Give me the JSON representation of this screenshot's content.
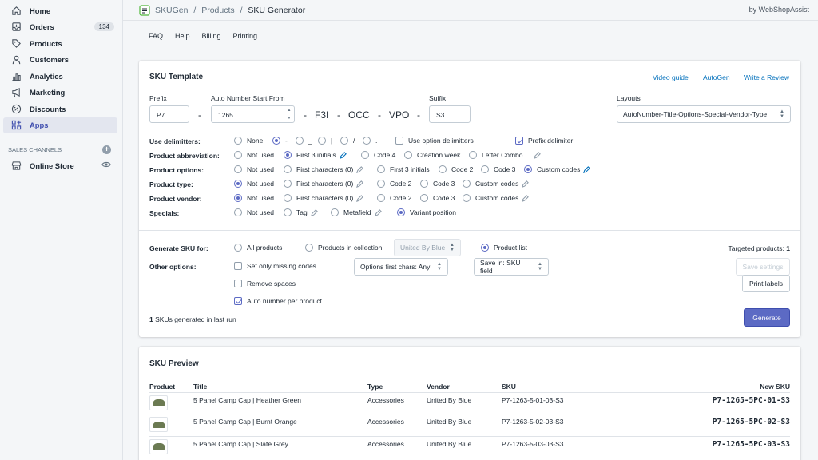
{
  "nav": {
    "items": [
      {
        "label": "Home",
        "icon": "home-icon"
      },
      {
        "label": "Orders",
        "icon": "orders-icon",
        "badge": "134"
      },
      {
        "label": "Products",
        "icon": "tag-icon"
      },
      {
        "label": "Customers",
        "icon": "person-icon"
      },
      {
        "label": "Analytics",
        "icon": "bar-chart-icon"
      },
      {
        "label": "Marketing",
        "icon": "megaphone-icon"
      },
      {
        "label": "Discounts",
        "icon": "discount-icon"
      },
      {
        "label": "Apps",
        "icon": "apps-icon"
      }
    ],
    "channels_label": "SALES CHANNELS",
    "online_store": "Online Store"
  },
  "topbar": {
    "crumb_app": "SKUGen",
    "crumb_sep1": "/",
    "crumb_products": "Products",
    "crumb_sep2": "/",
    "crumb_current": "SKU Generator",
    "byline": "by WebShopAssist"
  },
  "subnav": [
    "FAQ",
    "Help",
    "Billing",
    "Printing"
  ],
  "template": {
    "title": "SKU Template",
    "links": {
      "video": "Video guide",
      "autogen": "AutoGen",
      "review": "Write a Review"
    },
    "prefix_label": "Prefix",
    "prefix_value": "P7",
    "dash1": "-",
    "start_label": "Auto Number Start From",
    "start_value": "1265",
    "tokens": {
      "d2": "-",
      "t1": "F3I",
      "d3": "-",
      "t2": "OCC",
      "d4": "-",
      "t3": "VPO",
      "d5": "-"
    },
    "suffix_label": "Suffix",
    "suffix_value": "S3",
    "layouts_label": "Layouts",
    "layouts_value": "AutoNumber-Title-Options-Special-Vendor-Type",
    "delim_label": "Use delimitters:",
    "delims": {
      "none": "None",
      "dash": "-",
      "underscore": "_",
      "pipe": "|",
      "slash": "/",
      "dot": "."
    },
    "use_option_delims": "Use option delimitters",
    "prefix_delim": "Prefix delimiter",
    "abbr_label": "Product abbreviation:",
    "abbr": {
      "a": "Not used",
      "b": "First 3 initials",
      "c": "Code 4",
      "d": "Creation week",
      "e": "Letter Combo ..."
    },
    "opts_label": "Product options:",
    "opts": {
      "a": "Not used",
      "b": "First characters",
      "b_sub": "(0)",
      "c": "First 3 initials",
      "d": "Code 2",
      "e": "Code 3",
      "f": "Custom codes"
    },
    "type_label": "Product type:",
    "type": {
      "a": "Not used",
      "b": "First characters",
      "b_sub": "(0)",
      "c": "Code 2",
      "d": "Code 3",
      "e": "Custom codes"
    },
    "vendor_label": "Product vendor:",
    "vendor": {
      "a": "Not used",
      "b": "First characters",
      "b_sub": "(0)",
      "c": "Code 2",
      "d": "Code 3",
      "e": "Custom codes"
    },
    "specials_label": "Specials:",
    "specials": {
      "a": "Not used",
      "b": "Tag",
      "c": "Metafield",
      "d": "Variant position"
    }
  },
  "generate": {
    "for_label": "Generate SKU for:",
    "all": "All products",
    "collection": "Products in collection",
    "collection_select": "United By Blue",
    "list": "Product list",
    "targeted_label": "Targeted products:",
    "targeted_value": "1",
    "other_label": "Other options:",
    "missing": "Set only missing codes",
    "spaces": "Remove spaces",
    "autonum": "Auto number per product",
    "opt_chars": "Options first chars: Any",
    "save_in": "Save in: SKU field",
    "save_settings": "Save settings",
    "print_labels": "Print labels",
    "run_count": "1",
    "run_text": "SKUs generated in last run",
    "generate_btn": "Generate"
  },
  "preview": {
    "title": "SKU Preview",
    "headers": {
      "product": "Product",
      "title": "Title",
      "type": "Type",
      "vendor": "Vendor",
      "sku": "SKU",
      "newsku": "New SKU"
    },
    "rows": [
      {
        "title": "5 Panel Camp Cap | Heather Green",
        "type": "Accessories",
        "vendor": "United By Blue",
        "sku": "P7-1263-5-01-03-S3",
        "newsku": "P7-1265-5PC-01-S3"
      },
      {
        "title": "5 Panel Camp Cap | Burnt Orange",
        "type": "Accessories",
        "vendor": "United By Blue",
        "sku": "P7-1263-5-02-03-S3",
        "newsku": "P7-1265-5PC-02-S3"
      },
      {
        "title": "5 Panel Camp Cap | Slate Grey",
        "type": "Accessories",
        "vendor": "United By Blue",
        "sku": "P7-1263-5-03-03-S3",
        "newsku": "P7-1265-5PC-03-S3"
      }
    ]
  },
  "colors": {
    "accent": "#5c6ac4",
    "link": "#006fbb"
  }
}
